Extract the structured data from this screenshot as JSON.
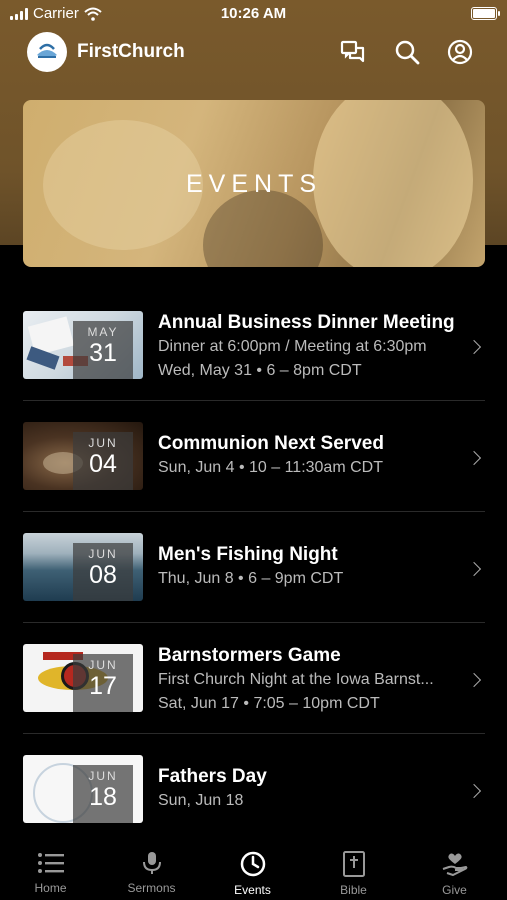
{
  "status_bar": {
    "carrier": "Carrier",
    "time": "10:26 AM"
  },
  "header": {
    "app_name": "FirstChurch"
  },
  "banner": {
    "title": "EVENTS"
  },
  "events": [
    {
      "month": "MAY",
      "day": "31",
      "title": "Annual Business Dinner Meeting",
      "line1": "Dinner at 6:00pm / Meeting at 6:30pm",
      "line2": "Wed, May 31 • 6 – 8pm CDT"
    },
    {
      "month": "JUN",
      "day": "04",
      "title": "Communion Next Served",
      "line1": "Sun, Jun 4 • 10 – 11:30am CDT"
    },
    {
      "month": "JUN",
      "day": "08",
      "title": "Men's Fishing Night",
      "line1": "Thu, Jun 8 • 6 – 9pm CDT"
    },
    {
      "month": "JUN",
      "day": "17",
      "title": "Barnstormers Game",
      "line1": "First Church Night at the Iowa Barnst...",
      "line2": "Sat, Jun 17 • 7:05 – 10pm CDT"
    },
    {
      "month": "JUN",
      "day": "18",
      "title": "Fathers Day",
      "line1": "Sun, Jun 18"
    }
  ],
  "tabs": [
    {
      "label": "Home",
      "icon": "list-icon"
    },
    {
      "label": "Sermons",
      "icon": "microphone-icon"
    },
    {
      "label": "Events",
      "icon": "clock-icon",
      "active": true
    },
    {
      "label": "Bible",
      "icon": "bible-icon"
    },
    {
      "label": "Give",
      "icon": "give-heart-icon"
    }
  ],
  "colors": {
    "header_bg": "#7a5a2c",
    "background": "#000000",
    "text": "#ffffff",
    "muted_text": "#bbbbbb"
  }
}
